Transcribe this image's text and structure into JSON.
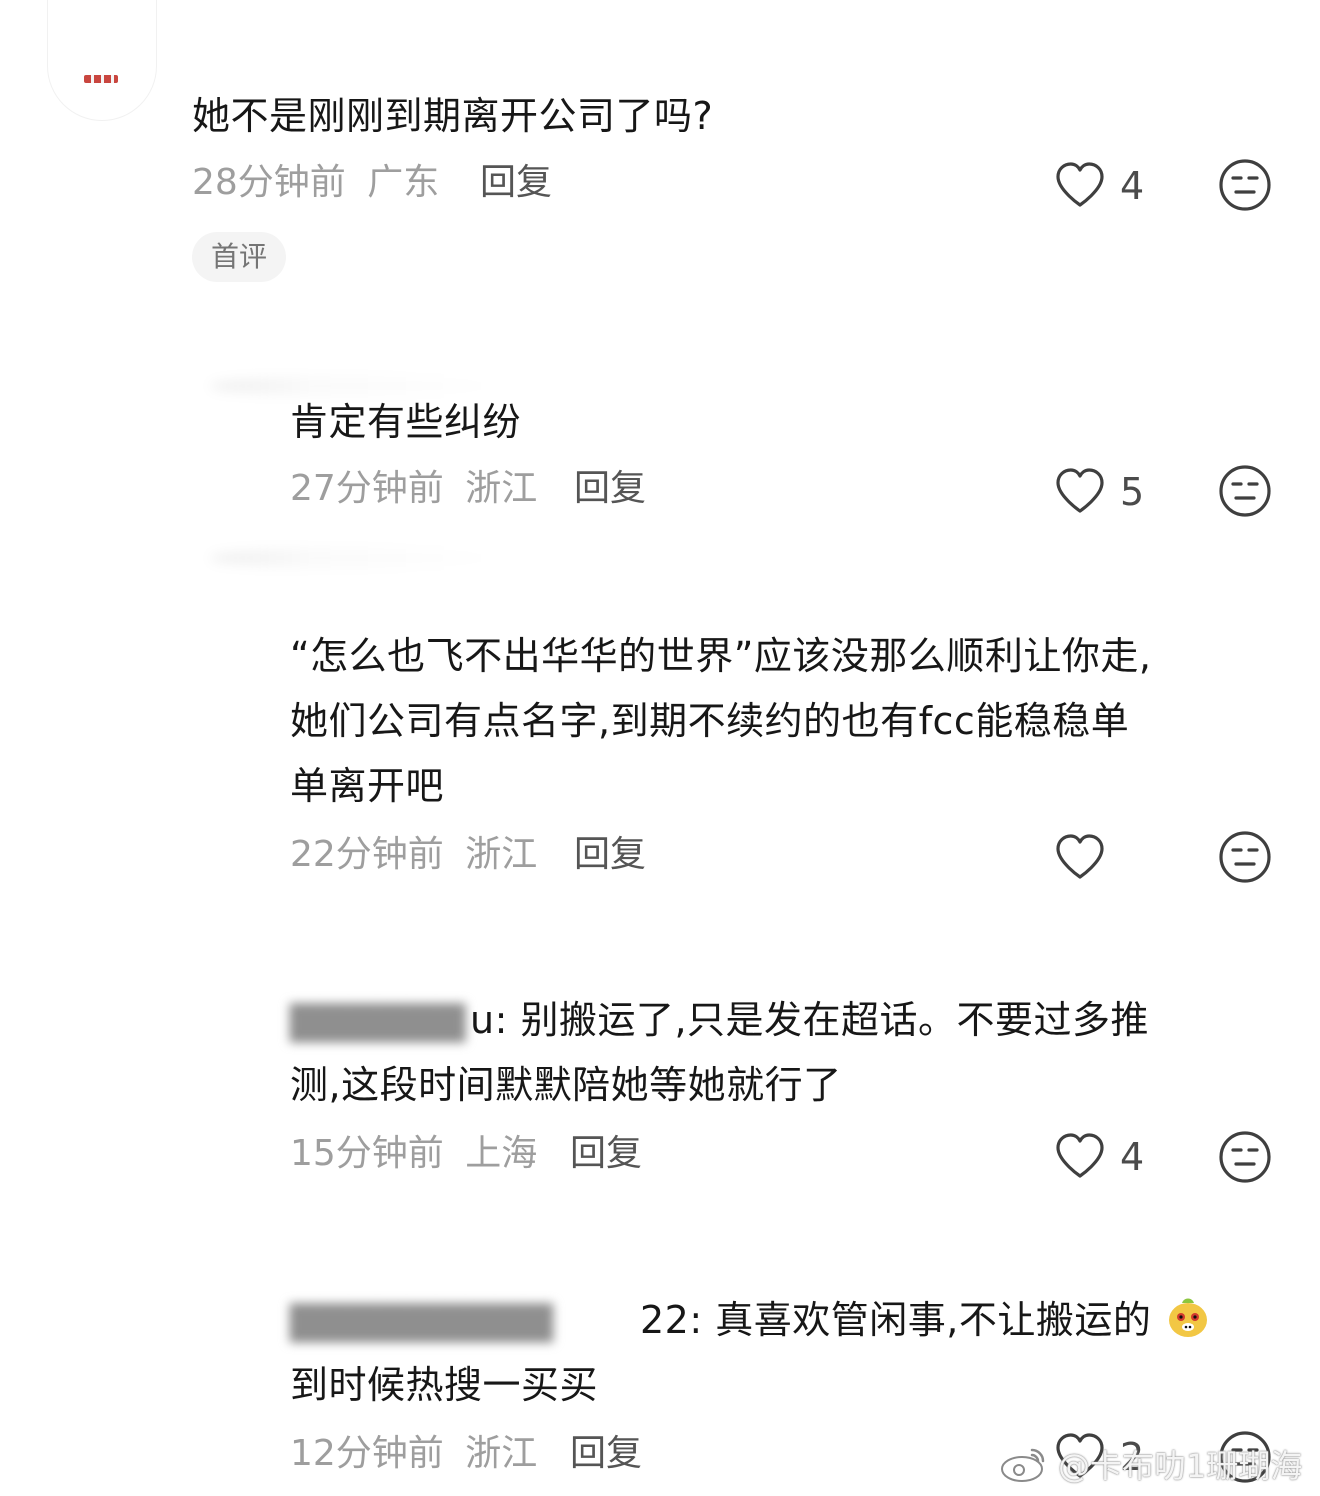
{
  "comments": [
    {
      "text": "她不是刚刚到期离开公司了吗?",
      "time": "28分钟前",
      "location": "广东",
      "reply_label": "回复",
      "badge": "首评",
      "likes": "4"
    },
    {
      "text": "肯定有些纠纷",
      "time": "27分钟前",
      "location": "浙江",
      "reply_label": "回复",
      "likes": "5"
    },
    {
      "lines": [
        "“怎么也飞不出华华的世界”应该没那么顺利让你走,",
        "她们公司有点名字,到期不续约的也有fcc能稳稳单",
        "单离开吧"
      ],
      "time": "22分钟前",
      "location": "浙江",
      "reply_label": "回复",
      "likes": ""
    },
    {
      "name": "u",
      "lines": [
        ": 别搬运了,只是发在超话。不要过多推",
        "测,这段时间默默陪她等她就行了"
      ],
      "time": "15分钟前",
      "location": "上海",
      "reply_label": "回复",
      "likes": "4"
    },
    {
      "name": "22",
      "lines": [
        ": 真喜欢管闲事,不让搬运的",
        "到时候热搜一买买"
      ],
      "time": "12分钟前",
      "location": "浙江",
      "reply_label": "回复",
      "likes": "2"
    }
  ],
  "watermark": {
    "text": "@卡布叻1珊瑚海"
  },
  "colors": {
    "text": "#171717",
    "meta": "#9e9e9e",
    "reply": "#555555",
    "badge_bg": "#f4f4f4",
    "icon": "#3f3f3f"
  },
  "icons": {
    "like": "heart-outline-icon",
    "dislike": "neutral-face-icon",
    "sticker": "cute-face-sticker-icon",
    "watermark": "weibo-logo-icon"
  }
}
